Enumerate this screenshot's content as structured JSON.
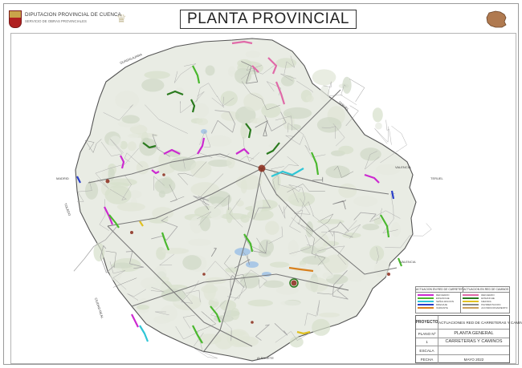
{
  "header": {
    "org_name": "DIPUTACION PROVINCIAL DE CUENCA",
    "org_dept": "SERVICIO DE OBRAS PROVINCIALES",
    "title": "PLANTA PROVINCIAL"
  },
  "map": {
    "neighbours": [
      "GUADALAJARA",
      "TERUEL",
      "VALENCIA",
      "TERUEL",
      "VALENCIA",
      "MADRID",
      "TOLEDO",
      "CIUDAD REAL",
      "ALBACETE"
    ],
    "road_colors": {
      "magenta": "#cc2ad0",
      "pink": "#e06aa8",
      "green": "#4ab82e",
      "dark_green": "#2a7a1e",
      "cyan": "#2fc6d6",
      "blue": "#2a3ec8",
      "orange": "#d8801e",
      "yellow": "#e0c020",
      "red_town": "#8a2a1a"
    }
  },
  "legend": {
    "col1_title": "ACTUACION EN RED DE CARRETERAS",
    "col2_title": "ACTUACION EN RED DE CAMINOS",
    "col1_items": [
      {
        "label": "REFUERZO",
        "color": "#cc2ad0"
      },
      {
        "label": "ENSANCHE",
        "color": "#4ab82e"
      },
      {
        "label": "SEÑALIZACION",
        "color": "#2fc6d6"
      },
      {
        "label": "DRENAJE",
        "color": "#2a3ec8"
      },
      {
        "label": "VARIANTE",
        "color": "#d8801e"
      }
    ],
    "col2_items": [
      {
        "label": "REFUERZO",
        "color": "#e06aa8"
      },
      {
        "label": "ENSANCHE",
        "color": "#2a7a1e"
      },
      {
        "label": "MEJORA",
        "color": "#e0c020"
      },
      {
        "label": "PAVIMENTACION",
        "color": "#8a8a8a"
      },
      {
        "label": "ACONDICIONAMIENTO",
        "color": "#c8a060"
      }
    ]
  },
  "title_block": {
    "project_key": "PROYECTO",
    "project_val": "ACTUACIONES RED DE CARRETERAS Y CAMINOS",
    "plan_key": "PLANO Nº",
    "plan_val": "PLANTA GENERAL",
    "plan_no": "1",
    "plan_sub": "CARRETERAS Y CAMINOS",
    "scale_key": "ESCALA",
    "date_key": "FECHA",
    "date_val": "MAYO 2022"
  }
}
